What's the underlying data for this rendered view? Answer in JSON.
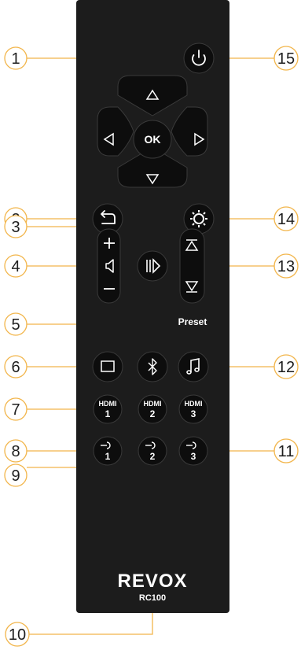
{
  "remote": {
    "brand": "REVOX",
    "model": "RC100",
    "ok_label": "OK",
    "preset_label": "Preset",
    "hdmi_label": "HDMI",
    "hdmi_inputs": [
      "1",
      "2",
      "3"
    ],
    "analog_inputs": [
      "1",
      "2",
      "3"
    ]
  },
  "callouts": [
    "1",
    "2",
    "3",
    "4",
    "5",
    "6",
    "7",
    "8",
    "9",
    "10",
    "11",
    "12",
    "13",
    "14",
    "15"
  ],
  "colors": {
    "body": "#1c1c1c",
    "button": "#0d0d0d",
    "button_border": "#3a3a3a",
    "callout_line": "#f2b54a",
    "callout_text": "#1e1e1e"
  },
  "icons": {
    "up": "triangle-up-icon",
    "down": "triangle-down-icon",
    "left": "triangle-left-icon",
    "right": "triangle-right-icon",
    "power": "power-icon",
    "back": "back-arrow-icon",
    "settings": "gear-icon",
    "play_pause": "play-pause-icon",
    "volume": "speaker-icon",
    "preset_up": "preset-up-icon",
    "preset_down": "preset-down-icon",
    "tv": "tv-icon",
    "bluetooth": "bluetooth-icon",
    "music": "music-note-icon",
    "analog_input": "analog-input-icon"
  }
}
